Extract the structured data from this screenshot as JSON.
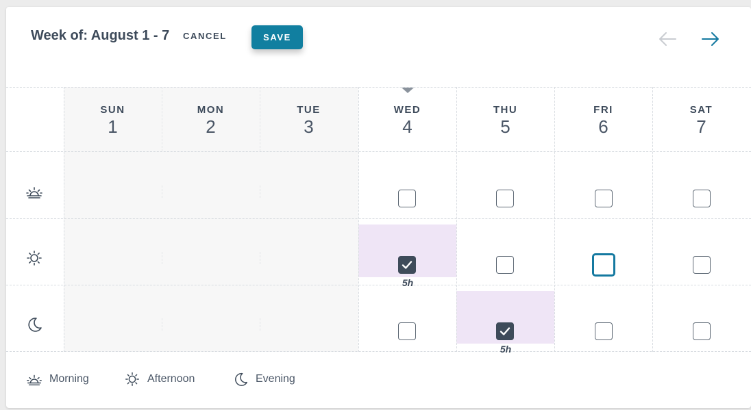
{
  "header": {
    "title": "Week of: August 1 - 7",
    "cancel_label": "CANCEL",
    "save_label": "SAVE",
    "prev_icon": "arrow-left-icon",
    "next_icon": "arrow-right-icon"
  },
  "days": [
    {
      "name": "SUN",
      "num": "1",
      "disabled": true
    },
    {
      "name": "MON",
      "num": "2",
      "disabled": true
    },
    {
      "name": "TUE",
      "num": "3",
      "disabled": true
    },
    {
      "name": "WED",
      "num": "4",
      "disabled": false,
      "today": true
    },
    {
      "name": "THU",
      "num": "5",
      "disabled": false
    },
    {
      "name": "FRI",
      "num": "6",
      "disabled": false
    },
    {
      "name": "SAT",
      "num": "7",
      "disabled": false
    }
  ],
  "rows": [
    {
      "slot": "morning",
      "icon": "sunrise-icon",
      "checked": [],
      "focused": []
    },
    {
      "slot": "afternoon",
      "icon": "sun-icon",
      "checked": [
        "WED"
      ],
      "focused": [
        "FRI"
      ],
      "hours": {
        "WED": "5h"
      }
    },
    {
      "slot": "evening",
      "icon": "moon-icon",
      "checked": [
        "THU"
      ],
      "focused": [],
      "hours": {
        "THU": "5h"
      }
    }
  ],
  "legend": [
    {
      "icon": "sunrise-icon",
      "label": "Morning"
    },
    {
      "icon": "sun-icon",
      "label": "Afternoon"
    },
    {
      "icon": "moon-icon",
      "label": "Evening"
    }
  ],
  "colors": {
    "accent": "#117fa0",
    "selected_bg": "#efe5f6",
    "checked_box": "#3e4b5a",
    "disabled_bg": "#f7f7f7"
  }
}
